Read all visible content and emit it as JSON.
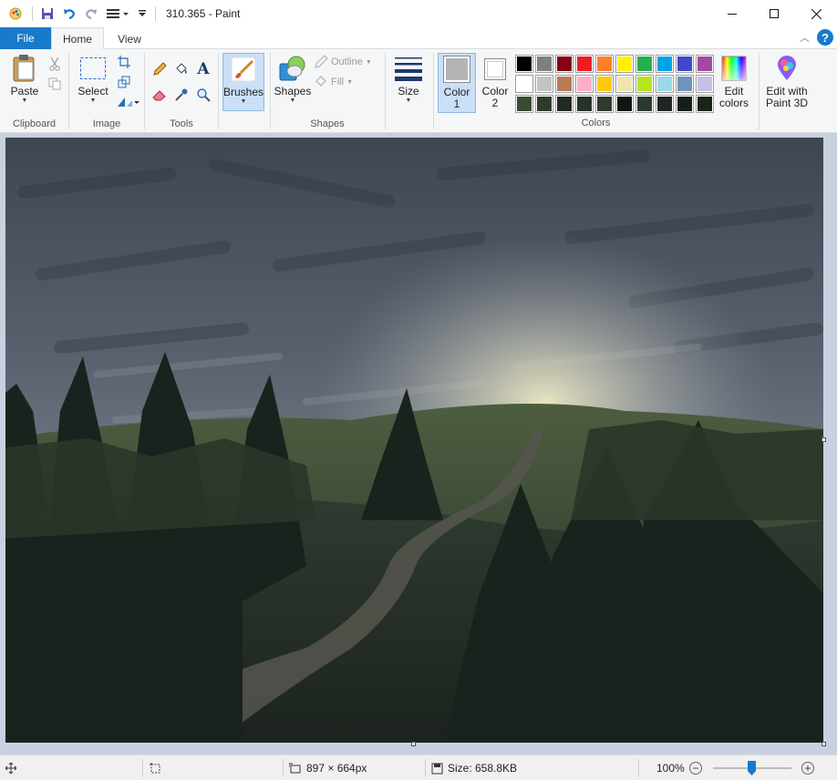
{
  "window": {
    "title": "310.365 - Paint"
  },
  "tabs": {
    "file": "File",
    "home": "Home",
    "view": "View"
  },
  "clipboard": {
    "paste": "Paste",
    "group": "Clipboard"
  },
  "image": {
    "select": "Select",
    "group": "Image"
  },
  "tools": {
    "group": "Tools"
  },
  "brushes": {
    "label": "Brushes"
  },
  "shapes": {
    "label": "Shapes",
    "outline": "Outline",
    "fill": "Fill",
    "group": "Shapes"
  },
  "size": {
    "label": "Size"
  },
  "colors": {
    "color1_label": "Color",
    "color1_num": "1",
    "color2_label": "Color",
    "color2_num": "2",
    "edit_label_1": "Edit",
    "edit_label_2": "colors",
    "group": "Colors",
    "color1_value": "#b4b4b4",
    "color2_value": "#ffffff",
    "palette": [
      "#000000",
      "#7f7f7f",
      "#880015",
      "#ed1c24",
      "#ff7f27",
      "#fff200",
      "#22b14c",
      "#00a2e8",
      "#3f48cc",
      "#a349a4",
      "#ffffff",
      "#c3c3c3",
      "#b97a57",
      "#ffaec9",
      "#ffc90e",
      "#efe4b0",
      "#b5e61d",
      "#99d9ea",
      "#7092be",
      "#c8bfe7",
      "#3b4a33",
      "#2e3b2a",
      "#1f2a22",
      "#26322a",
      "#2f3b2f",
      "#101612",
      "#2b3a30",
      "#1e2621",
      "#161e18",
      "#1b2419"
    ]
  },
  "paint3d": {
    "line1": "Edit with",
    "line2": "Paint 3D"
  },
  "status": {
    "dimensions": "897 × 664px",
    "size": "Size: 658.8KB",
    "zoom": "100%"
  }
}
